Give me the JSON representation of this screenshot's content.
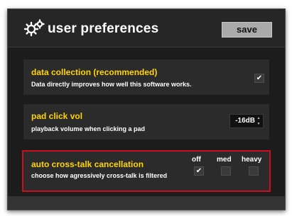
{
  "header": {
    "title": "user preferences",
    "save_label": "save",
    "icon": "gears-icon"
  },
  "preferences": {
    "data_collection": {
      "title": "data collection (recommended)",
      "description": "Data directly improves how well this software works.",
      "checked": true,
      "check_glyph": "✔"
    },
    "pad_click_vol": {
      "title": "pad click vol",
      "description": "playback volume when clicking a pad",
      "value": "-16dB"
    },
    "crosstalk": {
      "title": "auto cross-talk cancellation",
      "description": "choose how agressively cross-talk is filtered",
      "options": [
        {
          "label": "off",
          "checked": true,
          "glyph": "✔"
        },
        {
          "label": "med",
          "checked": false,
          "glyph": ""
        },
        {
          "label": "heavy",
          "checked": false,
          "glyph": ""
        }
      ],
      "highlighted": true
    }
  },
  "colors": {
    "accent_title": "#ffd400",
    "highlight_border": "#c8101f",
    "save_button": "#aaaaaa"
  }
}
